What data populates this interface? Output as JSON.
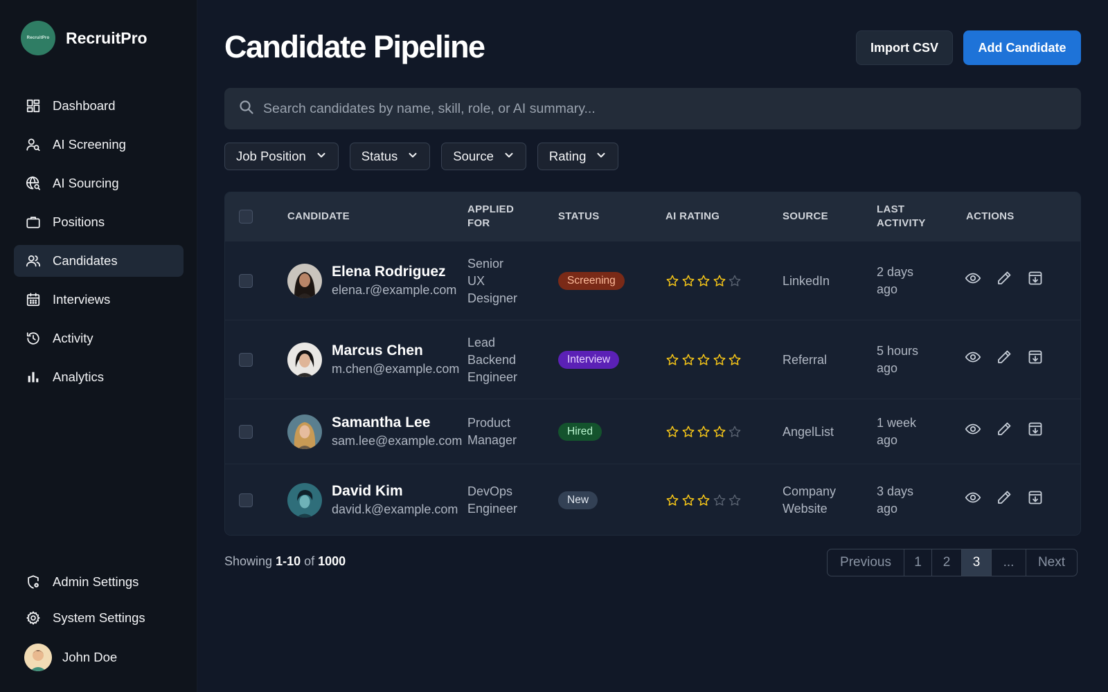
{
  "brand": {
    "name": "RecruitPro",
    "logo_text": "RecruitPro"
  },
  "sidebar": {
    "items": [
      {
        "label": "Dashboard",
        "icon": "dashboard-icon"
      },
      {
        "label": "AI Screening",
        "icon": "user-search-icon"
      },
      {
        "label": "AI Sourcing",
        "icon": "globe-search-icon"
      },
      {
        "label": "Positions",
        "icon": "briefcase-icon"
      },
      {
        "label": "Candidates",
        "icon": "users-icon",
        "active": true
      },
      {
        "label": "Interviews",
        "icon": "calendar-icon"
      },
      {
        "label": "Activity",
        "icon": "history-icon"
      },
      {
        "label": "Analytics",
        "icon": "bar-chart-icon"
      }
    ],
    "bottom_items": [
      {
        "label": "Admin Settings",
        "icon": "shield-gear-icon"
      },
      {
        "label": "System Settings",
        "icon": "gear-icon"
      }
    ],
    "user": {
      "name": "John Doe"
    }
  },
  "header": {
    "title": "Candidate Pipeline",
    "import_label": "Import CSV",
    "add_label": "Add Candidate"
  },
  "search": {
    "placeholder": "Search candidates by name, skill, role, or AI summary...",
    "value": ""
  },
  "filters": [
    "Job Position",
    "Status",
    "Source",
    "Rating"
  ],
  "table": {
    "columns": {
      "candidate": "CANDIDATE",
      "applied_line1": "APPLIED",
      "applied_line2": "FOR",
      "status": "STATUS",
      "ai_rating": "AI RATING",
      "source": "SOURCE",
      "activity_line1": "LAST",
      "activity_line2": "ACTIVITY",
      "actions": "ACTIONS"
    },
    "rows": [
      {
        "name": "Elena Rodriguez",
        "email": "elena.r@example.com",
        "applied": [
          "Senior",
          "UX",
          "Designer"
        ],
        "status": "Screening",
        "status_type": "screening",
        "rating": 4,
        "source": [
          "LinkedIn"
        ],
        "activity": [
          "2 days",
          "ago"
        ]
      },
      {
        "name": "Marcus Chen",
        "email": "m.chen@example.com",
        "applied": [
          "Lead",
          "Backend",
          "Engineer"
        ],
        "status": "Interview",
        "status_type": "interview",
        "rating": 5,
        "source": [
          "Referral"
        ],
        "activity": [
          "5 hours",
          "ago"
        ]
      },
      {
        "name": "Samantha Lee",
        "email": "sam.lee@example.com",
        "applied": [
          "Product",
          "Manager"
        ],
        "status": "Hired",
        "status_type": "hired",
        "rating": 4,
        "source": [
          "AngelList"
        ],
        "activity": [
          "1 week",
          "ago"
        ]
      },
      {
        "name": "David Kim",
        "email": "david.k@example.com",
        "applied": [
          "DevOps",
          "Engineer"
        ],
        "status": "New",
        "status_type": "new",
        "rating": 3,
        "source": [
          "Company",
          "Website"
        ],
        "activity": [
          "3 days",
          "ago"
        ]
      }
    ]
  },
  "footer": {
    "showing_prefix": "Showing",
    "range": "1-10",
    "of": "of",
    "total": "1000"
  },
  "pagination": {
    "previous": "Previous",
    "pages": [
      "1",
      "2",
      "3",
      "..."
    ],
    "active_page": "3",
    "next": "Next"
  },
  "colors": {
    "background": "#111827",
    "sidebar": "#0f141c",
    "accent": "#1e73d8",
    "star": "#f5c518",
    "status_screening": "#7a2a17",
    "status_interview": "#5b21b6",
    "status_hired": "#14532d",
    "status_new": "#334155"
  }
}
